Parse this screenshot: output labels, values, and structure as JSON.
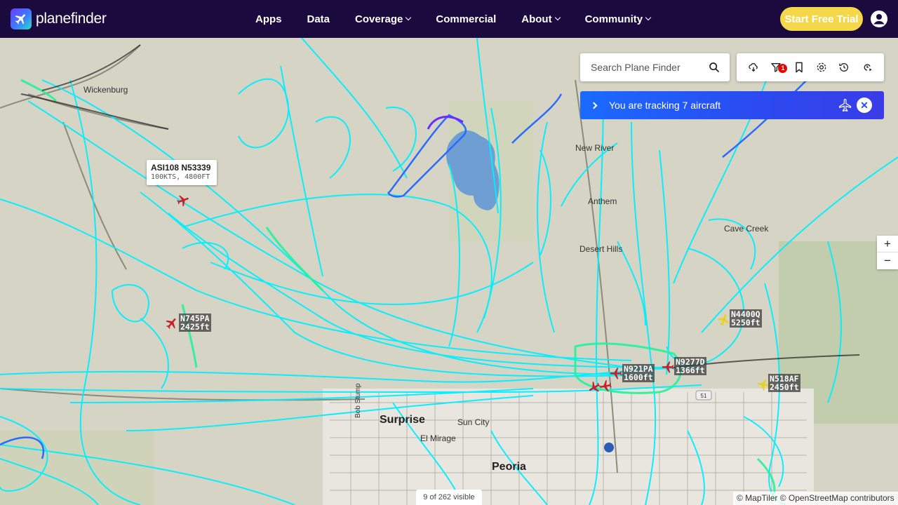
{
  "brand": {
    "name": "planefinder"
  },
  "nav": {
    "items": [
      {
        "label": "Apps",
        "dropdown": false
      },
      {
        "label": "Data",
        "dropdown": false
      },
      {
        "label": "Coverage",
        "dropdown": true
      },
      {
        "label": "Commercial",
        "dropdown": false
      },
      {
        "label": "About",
        "dropdown": true
      },
      {
        "label": "Community",
        "dropdown": true
      }
    ],
    "cta_label": "Start Free Trial"
  },
  "search": {
    "placeholder": "Search Plane Finder"
  },
  "toolbar": {
    "tools": [
      "weather-icon",
      "filter-icon",
      "bookmark-icon",
      "settings-icon",
      "history-icon",
      "playback-icon"
    ],
    "filter_badge": "1"
  },
  "tracking": {
    "text": "You are tracking 7 aircraft"
  },
  "zoom": {
    "in_label": "+",
    "out_label": "−"
  },
  "places": [
    {
      "name": "Wickenburg",
      "size": "small"
    },
    {
      "name": "New River",
      "size": "small"
    },
    {
      "name": "Anthem",
      "size": "small"
    },
    {
      "name": "Desert Hills",
      "size": "small"
    },
    {
      "name": "Cave Creek",
      "size": "small"
    },
    {
      "name": "Surprise",
      "size": "big"
    },
    {
      "name": "Sun City",
      "size": "small"
    },
    {
      "name": "El Mirage",
      "size": "small"
    },
    {
      "name": "Peoria",
      "size": "big"
    },
    {
      "name": "Bob Stump",
      "size": "small"
    }
  ],
  "selected_aircraft": {
    "callsign": "ASI108 N53339",
    "details": "100KTS, 4800FT"
  },
  "aircraft": [
    {
      "reg": "N745PA",
      "alt": "2425ft"
    },
    {
      "reg": "N4400Q",
      "alt": "5250ft"
    },
    {
      "reg": "N9277D",
      "alt": "1366ft"
    },
    {
      "reg": "N921PA",
      "alt": "1600ft"
    },
    {
      "reg": "N518AF",
      "alt": "2450ft"
    }
  ],
  "status": {
    "visible_count": "9 of 262 visible"
  },
  "attribution": "© MapTiler © OpenStreetMap contributors",
  "colors": {
    "nav_bg": "#1a0a3e",
    "cta": "#f5d84a",
    "track_cyan": "#00f0ff",
    "track_green": "#22f29a",
    "track_blue": "#1a6bff",
    "tracking_bar": "#2a4cf0"
  }
}
